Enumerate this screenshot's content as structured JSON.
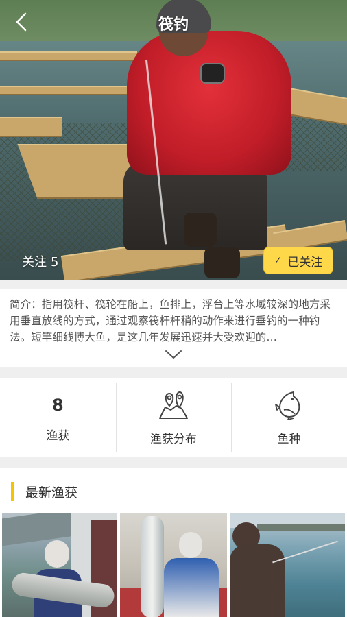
{
  "header": {
    "title": "筏钓",
    "back_icon": "chevron-left-icon"
  },
  "follow": {
    "label": "关注",
    "count": "5",
    "button_label": "已关注",
    "button_icon": "check-icon",
    "button_color": "#ffd84a"
  },
  "description": {
    "text": "简介：指用筏杆、筏轮在船上，鱼排上，浮台上等水域较深的地方采用垂直放线的方式，通过观察筏杆杆稍的动作来进行垂钓的一种钓法。短竿细线博大鱼，是这几年发展迅速并大受欢迎的…",
    "expand_icon": "chevron-down-icon"
  },
  "stats": [
    {
      "value": "8",
      "label": "渔获"
    },
    {
      "icon": "map-pin-icon",
      "label": "渔获分布"
    },
    {
      "icon": "fish-icon",
      "label": "鱼种"
    }
  ],
  "latest": {
    "title": "最新渔获",
    "accent_color": "#f5c400"
  }
}
